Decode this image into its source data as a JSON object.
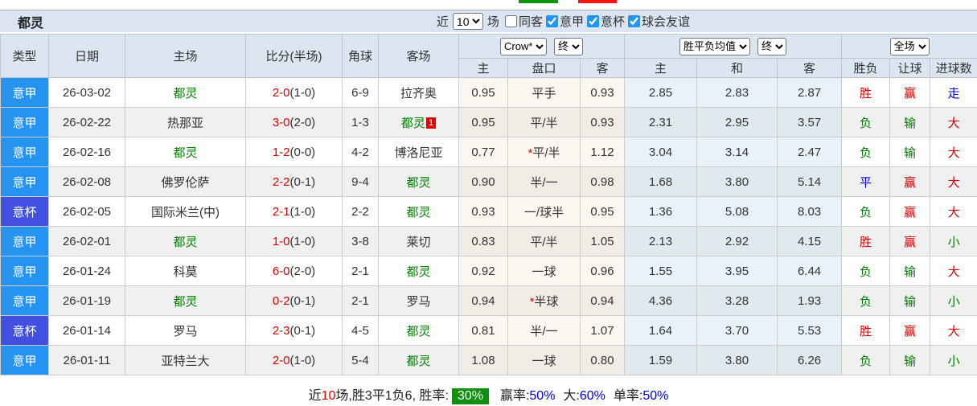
{
  "top_bars": {
    "left_color": "#0a960a",
    "right_color": "#fb1414"
  },
  "header_bar": {
    "team": "都灵",
    "recent_label": "近",
    "recent_value": "10",
    "games_label": "场",
    "checkboxes": [
      {
        "label": "同客",
        "checked": false
      },
      {
        "label": "意甲",
        "checked": true
      },
      {
        "label": "意杯",
        "checked": true
      },
      {
        "label": "球会友谊",
        "checked": true
      }
    ]
  },
  "table": {
    "columns": [
      "类型",
      "日期",
      "主场",
      "比分(半场)",
      "角球",
      "客场"
    ],
    "selects": {
      "company": "Crow*",
      "company_time": "终",
      "avg": "胜平负均值",
      "avg_time": "终",
      "scope": "全场"
    },
    "sub_columns": [
      "主",
      "盘口",
      "客",
      "主",
      "和",
      "客",
      "胜负",
      "让球",
      "进球数"
    ],
    "rows": [
      {
        "type": "意甲",
        "type_key": "league",
        "date": "26-03-02",
        "home": {
          "name": "都灵",
          "self": true
        },
        "score": "2-0",
        "half": "(1-0)",
        "corner": "6-9",
        "away": {
          "name": "拉齐奥",
          "self": false
        },
        "odds": {
          "home": "0.95",
          "line": "平手",
          "star": false,
          "away": "0.93"
        },
        "avg": {
          "home": "2.85",
          "draw": "2.83",
          "away": "2.87"
        },
        "result": {
          "text": "胜",
          "color": "red"
        },
        "handicap_result": {
          "text": "赢",
          "color": "red"
        },
        "goals_result": {
          "text": "走",
          "color": "blue"
        }
      },
      {
        "type": "意甲",
        "type_key": "league",
        "date": "26-02-22",
        "home": {
          "name": "热那亚",
          "self": false
        },
        "score": "3-0",
        "half": "(2-0)",
        "corner": "1-3",
        "away": {
          "name": "都灵",
          "self": true,
          "badge": "1"
        },
        "odds": {
          "home": "0.95",
          "line": "平/半",
          "star": false,
          "away": "0.93"
        },
        "avg": {
          "home": "2.31",
          "draw": "2.95",
          "away": "3.57"
        },
        "result": {
          "text": "负",
          "color": "green"
        },
        "handicap_result": {
          "text": "输",
          "color": "green"
        },
        "goals_result": {
          "text": "大",
          "color": "red"
        }
      },
      {
        "type": "意甲",
        "type_key": "league",
        "date": "26-02-16",
        "home": {
          "name": "都灵",
          "self": true
        },
        "score": "1-2",
        "half": "(0-0)",
        "corner": "4-2",
        "away": {
          "name": "博洛尼亚",
          "self": false
        },
        "odds": {
          "home": "0.77",
          "line": "平/半",
          "star": true,
          "away": "1.12"
        },
        "avg": {
          "home": "3.04",
          "draw": "3.14",
          "away": "2.47"
        },
        "result": {
          "text": "负",
          "color": "green"
        },
        "handicap_result": {
          "text": "输",
          "color": "green"
        },
        "goals_result": {
          "text": "大",
          "color": "red"
        }
      },
      {
        "type": "意甲",
        "type_key": "league",
        "date": "26-02-08",
        "home": {
          "name": "佛罗伦萨",
          "self": false
        },
        "score": "2-2",
        "half": "(0-1)",
        "corner": "9-4",
        "away": {
          "name": "都灵",
          "self": true
        },
        "odds": {
          "home": "0.90",
          "line": "半/一",
          "star": false,
          "away": "0.98"
        },
        "avg": {
          "home": "1.68",
          "draw": "3.80",
          "away": "5.14"
        },
        "result": {
          "text": "平",
          "color": "blue"
        },
        "handicap_result": {
          "text": "赢",
          "color": "red"
        },
        "goals_result": {
          "text": "大",
          "color": "red"
        }
      },
      {
        "type": "意杯",
        "type_key": "cup",
        "date": "26-02-05",
        "home": {
          "name": "国际米兰(中)",
          "self": false
        },
        "score": "2-1",
        "half": "(1-0)",
        "corner": "2-2",
        "away": {
          "name": "都灵",
          "self": true
        },
        "odds": {
          "home": "0.93",
          "line": "一/球半",
          "star": false,
          "away": "0.95"
        },
        "avg": {
          "home": "1.36",
          "draw": "5.08",
          "away": "8.03"
        },
        "result": {
          "text": "负",
          "color": "green"
        },
        "handicap_result": {
          "text": "赢",
          "color": "red"
        },
        "goals_result": {
          "text": "大",
          "color": "red"
        }
      },
      {
        "type": "意甲",
        "type_key": "league",
        "date": "26-02-01",
        "home": {
          "name": "都灵",
          "self": true
        },
        "score": "1-0",
        "half": "(1-0)",
        "corner": "3-8",
        "away": {
          "name": "莱切",
          "self": false
        },
        "odds": {
          "home": "0.83",
          "line": "平/半",
          "star": false,
          "away": "1.05"
        },
        "avg": {
          "home": "2.13",
          "draw": "2.92",
          "away": "4.15"
        },
        "result": {
          "text": "胜",
          "color": "red"
        },
        "handicap_result": {
          "text": "赢",
          "color": "red"
        },
        "goals_result": {
          "text": "小",
          "color": "green"
        }
      },
      {
        "type": "意甲",
        "type_key": "league",
        "date": "26-01-24",
        "home": {
          "name": "科莫",
          "self": false
        },
        "score": "6-0",
        "half": "(2-0)",
        "corner": "2-1",
        "away": {
          "name": "都灵",
          "self": true
        },
        "odds": {
          "home": "0.92",
          "line": "一球",
          "star": false,
          "away": "0.96"
        },
        "avg": {
          "home": "1.55",
          "draw": "3.95",
          "away": "6.44"
        },
        "result": {
          "text": "负",
          "color": "green"
        },
        "handicap_result": {
          "text": "输",
          "color": "green"
        },
        "goals_result": {
          "text": "大",
          "color": "red"
        }
      },
      {
        "type": "意甲",
        "type_key": "league",
        "date": "26-01-19",
        "home": {
          "name": "都灵",
          "self": true
        },
        "score": "0-2",
        "half": "(0-1)",
        "corner": "2-1",
        "away": {
          "name": "罗马",
          "self": false
        },
        "odds": {
          "home": "0.94",
          "line": "半球",
          "star": true,
          "away": "0.94"
        },
        "avg": {
          "home": "4.36",
          "draw": "3.28",
          "away": "1.93"
        },
        "result": {
          "text": "负",
          "color": "green"
        },
        "handicap_result": {
          "text": "输",
          "color": "green"
        },
        "goals_result": {
          "text": "小",
          "color": "green"
        }
      },
      {
        "type": "意杯",
        "type_key": "cup",
        "date": "26-01-14",
        "home": {
          "name": "罗马",
          "self": false
        },
        "score": "2-3",
        "half": "(0-1)",
        "corner": "4-5",
        "away": {
          "name": "都灵",
          "self": true
        },
        "odds": {
          "home": "0.81",
          "line": "半/一",
          "star": false,
          "away": "1.07"
        },
        "avg": {
          "home": "1.64",
          "draw": "3.70",
          "away": "5.53"
        },
        "result": {
          "text": "胜",
          "color": "red"
        },
        "handicap_result": {
          "text": "赢",
          "color": "red"
        },
        "goals_result": {
          "text": "大",
          "color": "red"
        }
      },
      {
        "type": "意甲",
        "type_key": "league",
        "date": "26-01-11",
        "home": {
          "name": "亚特兰大",
          "self": false
        },
        "score": "2-0",
        "half": "(1-0)",
        "corner": "5-4",
        "away": {
          "name": "都灵",
          "self": true
        },
        "odds": {
          "home": "1.08",
          "line": "一球",
          "star": false,
          "away": "0.80"
        },
        "avg": {
          "home": "1.59",
          "draw": "3.80",
          "away": "6.26"
        },
        "result": {
          "text": "负",
          "color": "green"
        },
        "handicap_result": {
          "text": "输",
          "color": "green"
        },
        "goals_result": {
          "text": "小",
          "color": "green"
        }
      }
    ]
  },
  "footer": {
    "near_label": "近",
    "near_value": "10",
    "summary": "场,胜3平1负6, 胜率:",
    "win_rate": "30%",
    "win_rate_bg": "#109010",
    "win_odds_label": "赢率:",
    "win_odds_value": "50%",
    "big_label": "大:",
    "big_value": "60%",
    "single_label": "单率:",
    "single_value": "50%"
  }
}
